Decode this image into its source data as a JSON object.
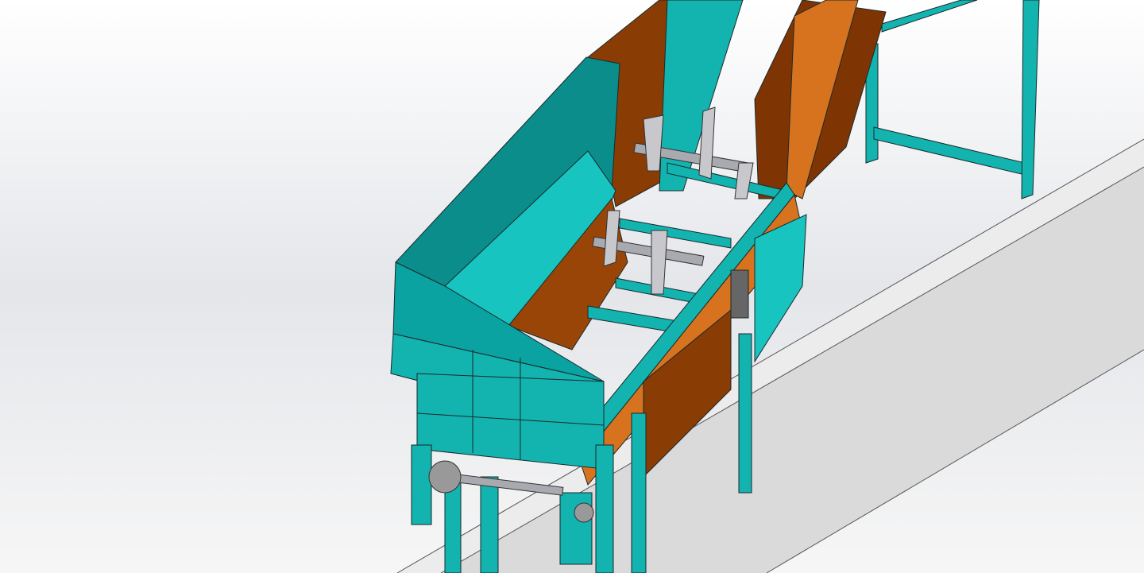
{
  "viewport": {
    "kind": "cad-3d-model-view",
    "colors": {
      "background_top": "#ffffff",
      "background_mid": "#e6e8ec",
      "floor": "#dcdcdc",
      "floor_edge": "#5a5a5a",
      "steel_teal": "#0fa8a8",
      "steel_teal_light": "#17c8c4",
      "steel_teal_dark": "#0a8a88",
      "chute_orange": "#8a3c05",
      "chute_orange_light": "#d7731f",
      "shaft_gray": "#a9aab0",
      "outline": "#1a2a2a"
    }
  }
}
